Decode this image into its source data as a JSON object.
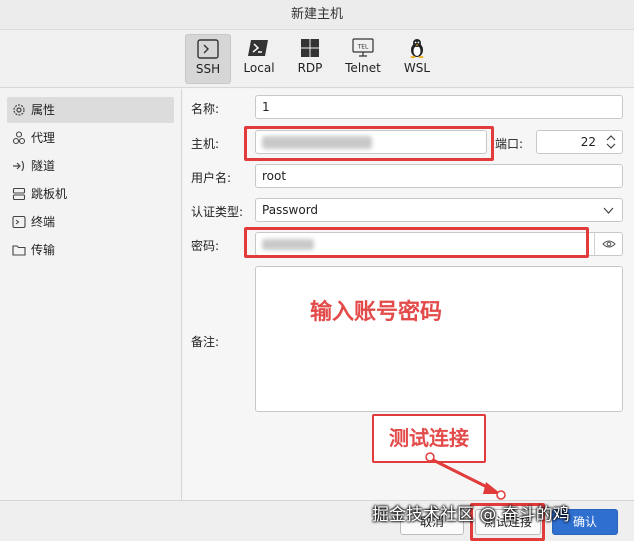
{
  "window": {
    "title": "新建主机"
  },
  "protocols": [
    {
      "label": "SSH",
      "icon": "terminal-icon",
      "active": true
    },
    {
      "label": "Local",
      "icon": "powershell-icon",
      "active": false
    },
    {
      "label": "RDP",
      "icon": "windows-icon",
      "active": false
    },
    {
      "label": "Telnet",
      "icon": "telnet-icon",
      "active": false
    },
    {
      "label": "WSL",
      "icon": "linux-penguin-icon",
      "active": false
    }
  ],
  "telnet_icon_text": "TEL",
  "sidebar": {
    "items": [
      {
        "label": "属性",
        "icon": "gear-icon",
        "active": true
      },
      {
        "label": "代理",
        "icon": "proxy-icon",
        "active": false
      },
      {
        "label": "隧道",
        "icon": "tunnel-icon",
        "active": false
      },
      {
        "label": "跳板机",
        "icon": "server-icon",
        "active": false
      },
      {
        "label": "终端",
        "icon": "terminal-icon",
        "active": false
      },
      {
        "label": "传输",
        "icon": "folder-icon",
        "active": false
      }
    ]
  },
  "form": {
    "name_label": "名称:",
    "name_value": "1",
    "host_label": "主机:",
    "port_label": "端口:",
    "port_value": "22",
    "username_label": "用户名:",
    "username_value": "root",
    "auth_label": "认证类型:",
    "auth_value": "Password",
    "password_label": "密码:",
    "note_label": "备注:"
  },
  "annotations": {
    "account_hint": "输入账号密码",
    "test_connection": "测试连接"
  },
  "footer": {
    "cancel_label": "取消",
    "test_label": "测试连接",
    "confirm_label": "确认"
  },
  "watermark": "掘金技术社区 @ 奋斗的鸡",
  "colors": {
    "annotation": "#e23b3b",
    "selected_bg": "#dcdcdc"
  }
}
